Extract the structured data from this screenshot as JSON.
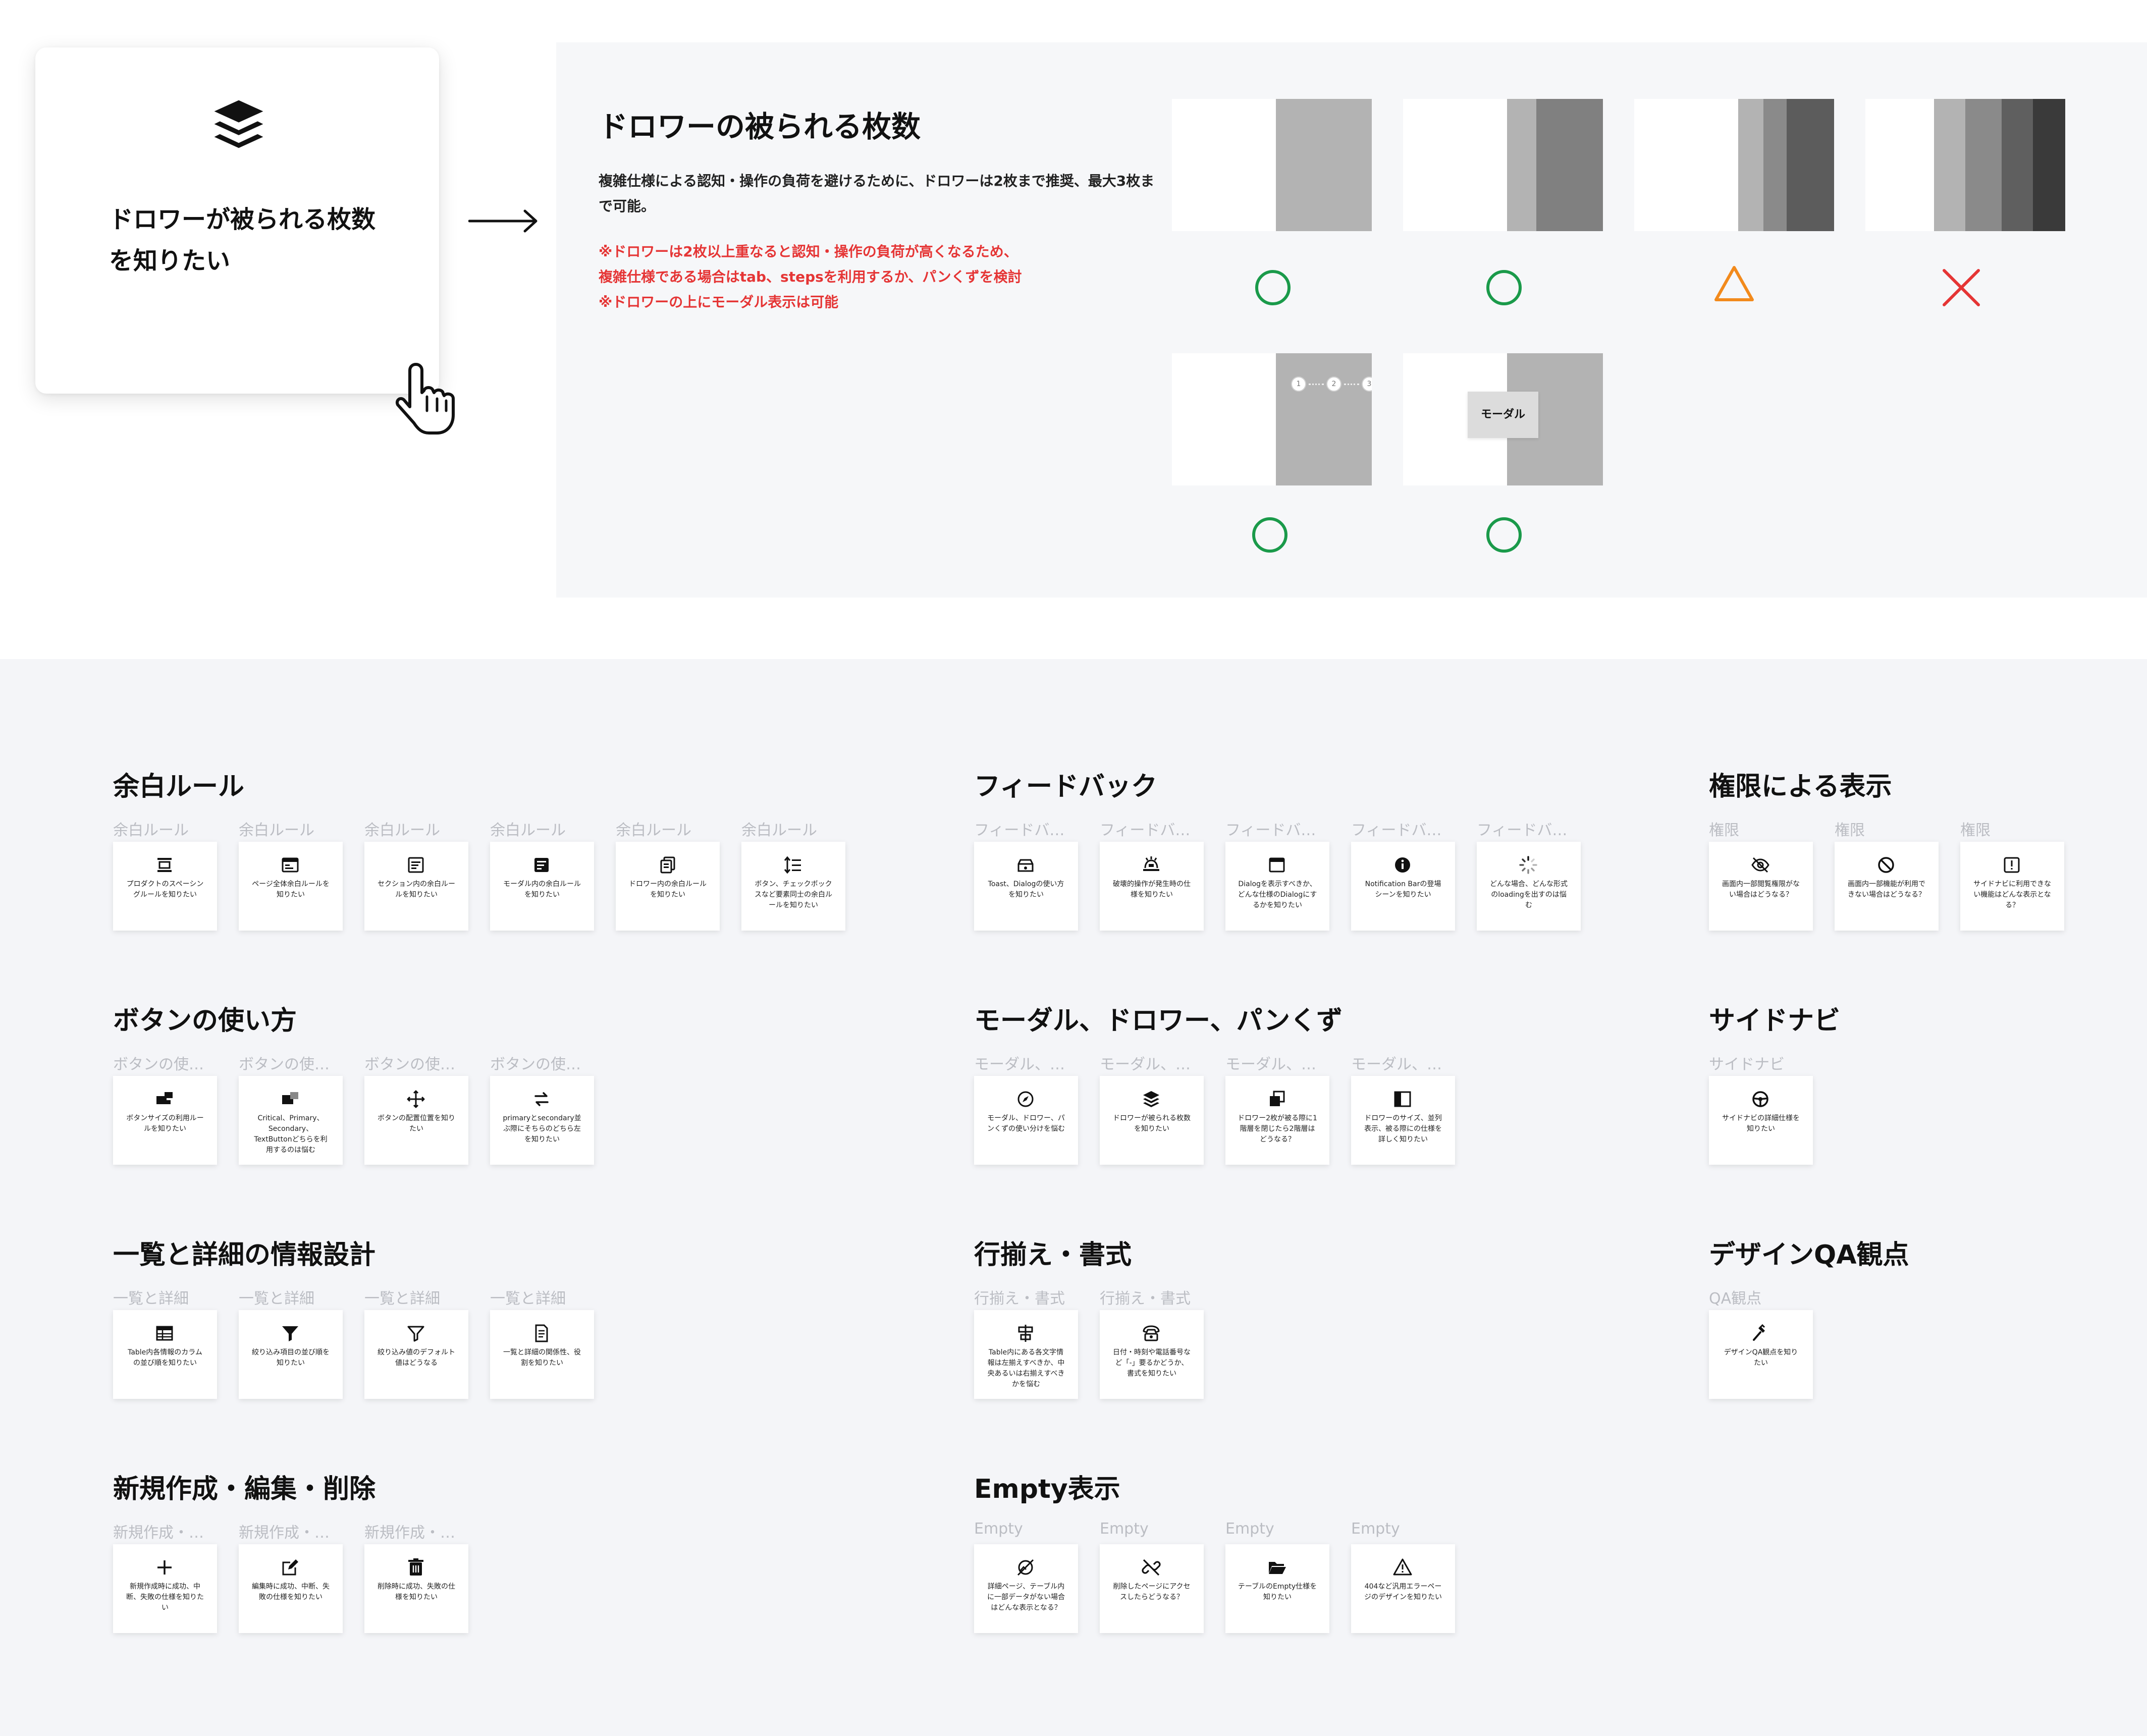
{
  "hero": {
    "icon": "layers-icon",
    "text": "ドロワーが被られる枚数を知りたい",
    "cursor_icon": "hand-pointer-icon",
    "arrow_icon": "right-arrow-icon"
  },
  "spec": {
    "title": "ドロワーの被られる枚数",
    "description": "複雑仕様による認知・操作の負荷を避けるために、ドロワーは2枚まで推奨、最大3枚まで可能。",
    "note": "※ドロワーは2枚以上重なると認知・操作の負荷が高くなるため、\n複雑仕様である場合はtab、stepsを利用するか、パンくずを検討\n※ドロワーの上にモーダル表示は可能",
    "modal_label": "モーダル",
    "stepper_steps": [
      "1",
      "2",
      "3"
    ],
    "marks": [
      {
        "symbol": "circle",
        "color": "#1a9a4a"
      },
      {
        "symbol": "circle",
        "color": "#1a9a4a"
      },
      {
        "symbol": "triangle",
        "color": "#f28a1c"
      },
      {
        "symbol": "cross",
        "color": "#e53535"
      },
      {
        "symbol": "circle",
        "color": "#1a9a4a"
      },
      {
        "symbol": "circle",
        "color": "#1a9a4a"
      }
    ]
  },
  "sections": [
    {
      "title": "余白ルール",
      "cards": [
        {
          "label": "余白ルール",
          "icon": "layout-header-icon",
          "text": "プロダクトのスペーシングルールを知りたい"
        },
        {
          "label": "余白ルール",
          "icon": "page-layout-icon",
          "text": "ページ全体余白ルールを知りたい"
        },
        {
          "label": "余白ルール",
          "icon": "section-icon",
          "text": "セクション内の余白ルールを知りたい"
        },
        {
          "label": "余白ルール",
          "icon": "modal-icon",
          "text": "モーダル内の余白ルールを知りたい"
        },
        {
          "label": "余白ルール",
          "icon": "drawer-stack-icon",
          "text": "ドロワー内の余白ルールを知りたい"
        },
        {
          "label": "余白ルール",
          "icon": "line-spacing-icon",
          "text": "ボタン、チェックボックスなど要素同士の余白ルールを知りたい"
        }
      ]
    },
    {
      "title": "フィードバック",
      "cards": [
        {
          "label": "フィードバック",
          "icon": "toast-icon",
          "text": "Toast、Dialogの使い方を知りたい"
        },
        {
          "label": "フィードバック",
          "icon": "destructive-icon",
          "text": "破壊的操作が発生時の仕様を知りたい"
        },
        {
          "label": "フィードバック",
          "icon": "dialog-icon",
          "text": "Dialogを表示すべきか、どんな仕様のDialogにするかを知りたい"
        },
        {
          "label": "フィードバック",
          "icon": "info-icon",
          "text": "Notification Barの登場シーンを知りたい"
        },
        {
          "label": "フィードバック",
          "icon": "loading-icon",
          "text": "どんな場合、どんな形式のloadingを出すのは悩む"
        }
      ]
    },
    {
      "title": "権限による表示",
      "cards": [
        {
          "label": "権限",
          "icon": "eye-off-icon",
          "text": "画面内一部閲覧権限がない場合はどうなる？"
        },
        {
          "label": "権限",
          "icon": "block-icon",
          "text": "画面内一部機能が利用できない場合はどうなる？"
        },
        {
          "label": "権限",
          "icon": "alert-square-icon",
          "text": "サイドナビに利用できない機能はどんな表示となる？"
        }
      ]
    },
    {
      "title": "ボタンの使い方",
      "cards": [
        {
          "label": "ボタンの使い方",
          "icon": "button-size-icon",
          "text": "ボタンサイズの利用ルールを知りたい"
        },
        {
          "label": "ボタンの使い方",
          "icon": "button-type-icon",
          "text": "Critical、Primary、Secondary、TextButtonどちらを利用するのは悩む"
        },
        {
          "label": "ボタンの使い方",
          "icon": "move-icon",
          "text": "ボタンの配置位置を知りたい"
        },
        {
          "label": "ボタンの使い方",
          "icon": "swap-icon",
          "text": "primaryとsecondary並ぶ際にそちらのどちら左を知りたい"
        }
      ]
    },
    {
      "title": "モーダル、ドロワー、パンくず",
      "cards": [
        {
          "label": "モーダル、ドロワー",
          "icon": "compass-icon",
          "text": "モーダル、ドロワー、パンくずの使い分けを悩む"
        },
        {
          "label": "モーダル、ドロワー",
          "icon": "layers-icon",
          "text": "ドロワーが被られる枚数を知りたい"
        },
        {
          "label": "モーダル、ドロワー",
          "icon": "stack-icon",
          "text": "ドロワー2枚が被る際に1階層を閉じたら2階層はどうなる？"
        },
        {
          "label": "モーダル、ドロワー",
          "icon": "drawer-icon",
          "text": "ドロワーのサイズ、並列表示、被る際にの仕様を詳しく知りたい"
        }
      ]
    },
    {
      "title": "サイドナビ",
      "cards": [
        {
          "label": "サイドナビ",
          "icon": "steering-icon",
          "text": "サイドナビの詳細仕様を知りたい"
        }
      ]
    },
    {
      "title": "一覧と詳細の情報設計",
      "cards": [
        {
          "label": "一覧と詳細",
          "icon": "table-icon",
          "text": "Table内各情報のカラムの並び順を知りたい"
        },
        {
          "label": "一覧と詳細",
          "icon": "filter-icon",
          "text": "絞り込み項目の並び順を知りたい"
        },
        {
          "label": "一覧と詳細",
          "icon": "filter-outline-icon",
          "text": "絞り込み値のデフォルト値はどうなる"
        },
        {
          "label": "一覧と詳細",
          "icon": "document-icon",
          "text": "一覧と詳細の関係性、役割を知りたい"
        }
      ]
    },
    {
      "title": "行揃え・書式",
      "cards": [
        {
          "label": "行揃え・書式",
          "icon": "align-icon",
          "text": "Table内にある各文字情報は左揃えすべきか、中央あるいは右揃えすべきかを悩む"
        },
        {
          "label": "行揃え・書式",
          "icon": "phone-icon",
          "text": "日付・時刻や電話番号など「-」要るかどうか、書式を知りたい"
        }
      ]
    },
    {
      "title": "デザインQA観点",
      "cards": [
        {
          "label": "QA観点",
          "icon": "hammer-icon",
          "text": "デザインQA観点を知りたい"
        }
      ]
    },
    {
      "title": "新規作成・編集・削除",
      "cards": [
        {
          "label": "新規作成・編集",
          "icon": "plus-icon",
          "text": "新規作成時に成功、中断、失敗の仕様を知りたい"
        },
        {
          "label": "新規作成・編集",
          "icon": "edit-icon",
          "text": "編集時に成功、中断、失敗の仕様を知りたい"
        },
        {
          "label": "新規作成・編集",
          "icon": "trash-icon",
          "text": "削除時に成功、失敗の仕様を知りたい"
        }
      ]
    },
    {
      "title": "Empty表示",
      "cards": [
        {
          "label": "Empty",
          "icon": "no-image-icon",
          "text": "詳細ページ、テーブル内に一部データがない場合はどんな表示となる？"
        },
        {
          "label": "Empty",
          "icon": "broken-link-icon",
          "text": "削除したページにアクセスしたらどうなる？"
        },
        {
          "label": "Empty",
          "icon": "folder-open-icon",
          "text": "テーブルのEmpty仕様を知りたい"
        },
        {
          "label": "Empty",
          "icon": "warning-icon",
          "text": "404など汎用エラーページのデザインを知りたい"
        }
      ]
    }
  ]
}
